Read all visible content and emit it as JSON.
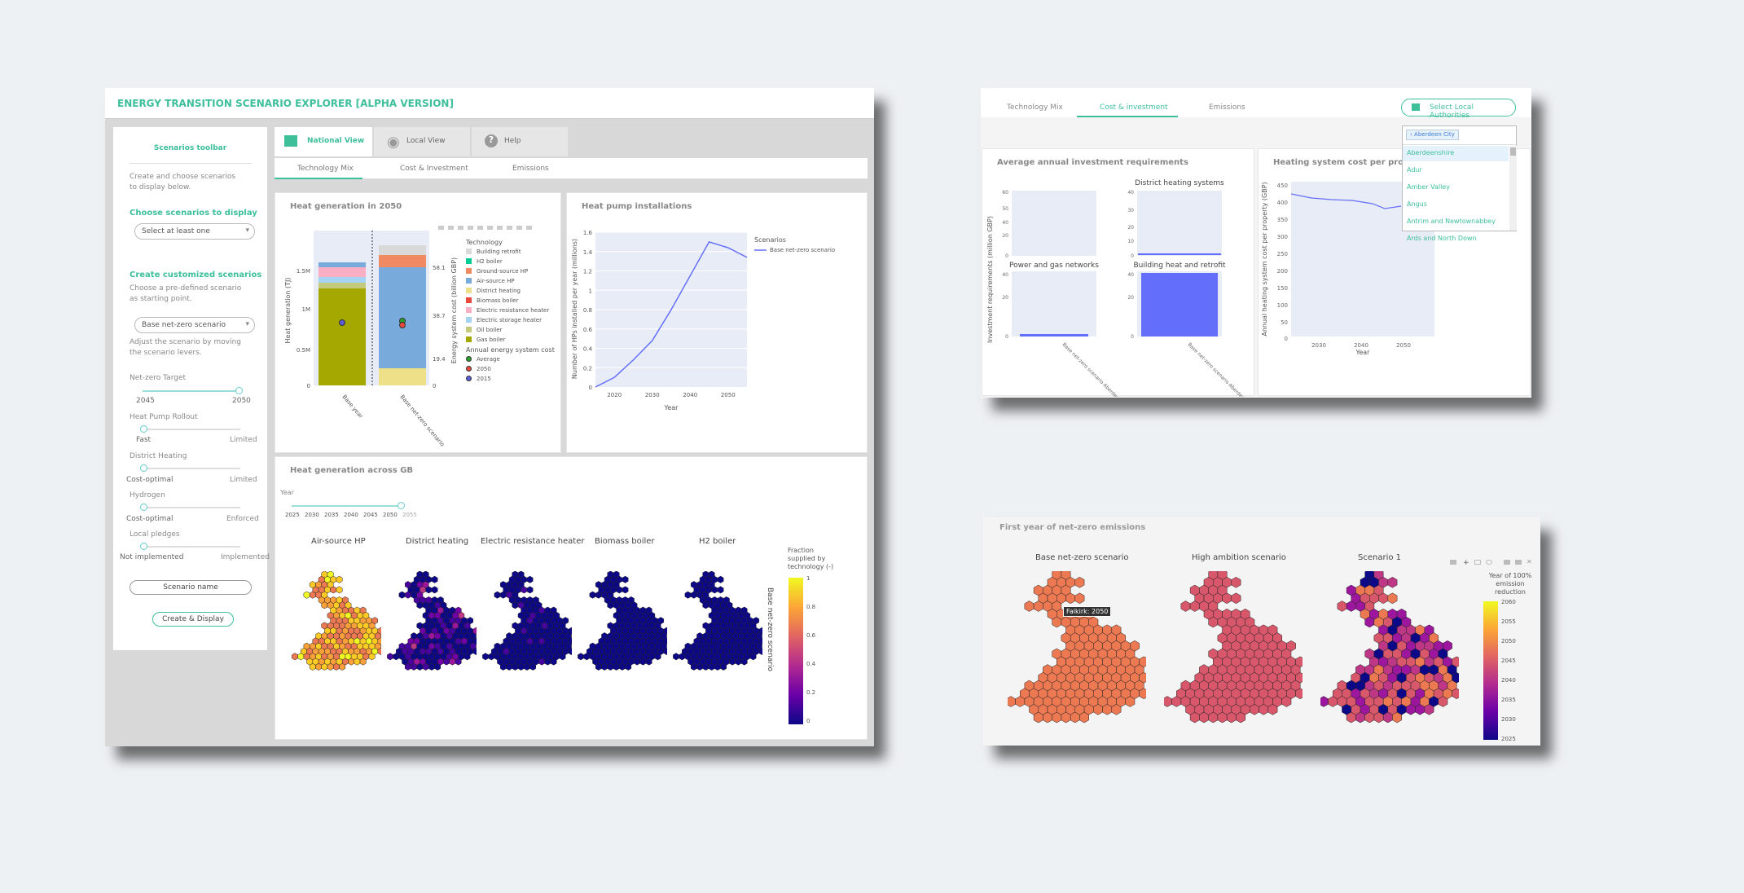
{
  "app": {
    "title": "ENERGY TRANSITION SCENARIO EXPLORER [ALPHA VERSION]"
  },
  "toolbar": {
    "heading": "Scenarios toolbar",
    "intro": "Create and choose scenarios to display below.",
    "choose_heading": "Choose scenarios to display",
    "select_placeholder": "Select at least one",
    "create_heading": "Create customized scenarios",
    "create_intro": "Choose a pre-defined scenario as starting point.",
    "base_scenario": "Base net-zero scenario",
    "adjust_text": "Adjust the scenario by moving the scenario levers.",
    "levers": [
      {
        "label": "Net-zero Target",
        "left": "2045",
        "right": "2050"
      },
      {
        "label": "Heat Pump Rollout",
        "left": "Fast",
        "right": "Limited"
      },
      {
        "label": "District Heating",
        "left": "Cost-optimal",
        "right": "Limited"
      },
      {
        "label": "Hydrogen",
        "left": "Cost-optimal",
        "right": "Enforced"
      },
      {
        "label": "Local pledges",
        "left": "Not implemented",
        "right": "Implemented"
      }
    ],
    "scenario_name_placeholder": "Scenario name",
    "create_button": "Create & Display"
  },
  "nav": {
    "tabs": [
      "National View",
      "Local View",
      "Help"
    ],
    "subtabs": [
      "Technology Mix",
      "Cost & Investment",
      "Emissions"
    ]
  },
  "heatgen": {
    "title": "Heat generation in 2050",
    "ylabel": "Heat generation (TJ)",
    "y2label": "Energy system cost (billion GBP)",
    "yticks": [
      "1.5M",
      "1M",
      "0.5M",
      "0"
    ],
    "y2ticks": [
      "58.1",
      "38.7",
      "19.4",
      "0"
    ],
    "categories": [
      "Base year",
      "Base net-zero scenario"
    ],
    "legend_title": "Technology",
    "legend": [
      "Building retrofit",
      "H2 boiler",
      "Ground-source HP",
      "Air-source HP",
      "District heating",
      "Biomass boiler",
      "Electric resistance heater",
      "Electric storage heater",
      "Oil boiler",
      "Gas boiler"
    ],
    "cost_title": "Annual energy system cost",
    "cost_items": [
      "Average",
      "2050",
      "2015"
    ]
  },
  "colors": {
    "accent": "#3dbf9a",
    "line": "#636efa",
    "building_retrofit": "#d9d9d9",
    "h2_boiler": "#00cc96",
    "ground_hp": "#ef8a62",
    "air_hp": "#78aadc",
    "district": "#ede089",
    "biomass": "#e8473c",
    "elec_res": "#f9aec3",
    "elec_store": "#a5d4f2",
    "oil": "#c5c97c",
    "gas": "#a4a800"
  },
  "hp": {
    "title": "Heat pump installations",
    "xlabel": "Year",
    "ylabel": "Number of HPs installed per year (millions)",
    "legend_title": "Scenarios",
    "series": "Base net-zero scenario",
    "xticks": [
      "2020",
      "2030",
      "2040",
      "2050"
    ],
    "yticks": [
      "1.6",
      "1.4",
      "1.2",
      "1",
      "0.8",
      "0.6",
      "0.4",
      "0.2",
      "0"
    ]
  },
  "chart_data": {
    "type": "line",
    "x": [
      2015,
      2020,
      2025,
      2030,
      2035,
      2040,
      2045,
      2050,
      2055
    ],
    "series": [
      {
        "name": "Base net-zero scenario",
        "values": [
          0.0,
          0.1,
          0.28,
          0.48,
          0.8,
          1.15,
          1.5,
          1.44,
          1.34
        ]
      }
    ],
    "xlabel": "Year",
    "ylabel": "Number of HPs installed per year (millions)",
    "title": "Heat pump installations",
    "ylim": [
      0,
      1.6
    ]
  },
  "gb": {
    "title": "Heat generation across GB",
    "year_label": "Year",
    "years": [
      "2025",
      "2030",
      "2035",
      "2040",
      "2045",
      "2050",
      "2055"
    ],
    "maps": [
      "Air-source HP",
      "District heating",
      "Electric resistance heater",
      "Biomass boiler",
      "H2 boiler"
    ],
    "cbar_title": "Fraction supplied by technology (-)",
    "cbar_ticks": [
      "1",
      "0.8",
      "0.6",
      "0.4",
      "0.2",
      "0"
    ],
    "side_label": "Base net-zero scenario"
  },
  "p2": {
    "tabs": [
      "Technology Mix",
      "Cost & investment",
      "Emissions"
    ],
    "select_btn": "Select Local Authorities",
    "chip": "Aberdeen City",
    "options": [
      "Aberdeenshire",
      "Adur",
      "Amber Valley",
      "Angus",
      "Antrim and Newtownabbey",
      "Ards and North Down"
    ],
    "inv_title": "Average annual investment requirements",
    "inv_ylabel": "Investment requirements (million GBP)",
    "subplots": [
      "District heating systems",
      "Power and gas networks",
      "Building heat and retrofit"
    ],
    "xcat": "Base net-zero scenario Aberdeen City",
    "cost_title": "Heating system cost per property",
    "cost_ylabel": "Annual heating system cost per property (GBP)",
    "cost_xlabel": "Year",
    "cost_yticks": [
      "450",
      "400",
      "350",
      "300",
      "250",
      "200",
      "150",
      "100",
      "50",
      "0"
    ],
    "cost_xticks": [
      "2030",
      "2040",
      "2050"
    ]
  },
  "p3": {
    "title": "First year of net-zero emissions",
    "maps": [
      "Base net-zero scenario",
      "High ambition scenario",
      "Scenario 1"
    ],
    "tooltip": "Falkirk: 2050",
    "cbar_title": "Year of 100% emission reduction",
    "cbar_ticks": [
      "2060",
      "2055",
      "2050",
      "2045",
      "2040",
      "2035",
      "2030",
      "2025"
    ]
  }
}
